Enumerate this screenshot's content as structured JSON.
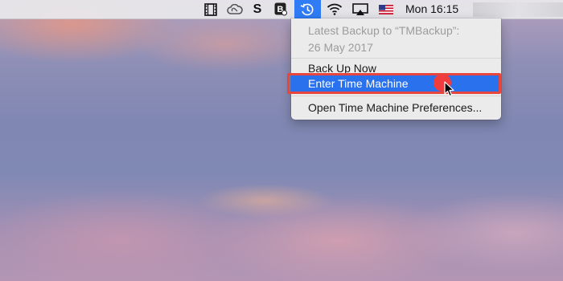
{
  "menubar": {
    "clock": "Mon 16:15",
    "icons": [
      "film-strip-icon",
      "creative-cloud-icon",
      "s-app-icon",
      "b-app-icon",
      "time-machine-icon",
      "wifi-icon",
      "airplay-icon",
      "flag-us-icon"
    ]
  },
  "menu": {
    "info_line1": "Latest Backup to “TMBackup”:",
    "info_line2": "26 May 2017",
    "back_up_now": "Back Up Now",
    "enter_time_machine": "Enter Time Machine",
    "open_preferences": "Open Time Machine Preferences..."
  },
  "colors": {
    "highlight": "#2a71ee",
    "annotation_red": "#e8453c",
    "menubar_active": "#2f7cf6"
  }
}
